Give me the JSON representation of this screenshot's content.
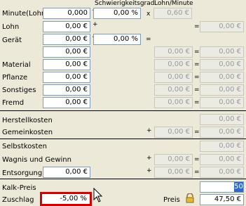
{
  "headers": {
    "difficulty": "Schwierigkeitsgrad",
    "wage_per_minute": "Lohn/Minute"
  },
  "operators": {
    "plus": "+",
    "times": "x",
    "equals": "="
  },
  "rows": {
    "minute_lohn": {
      "label": "Minute(Lohn)",
      "value": "0,000",
      "difficulty": "0,00 %",
      "wage": "0,60 €"
    },
    "lohn": {
      "label": "Lohn",
      "value": "0,00 €",
      "result": "0,00 €"
    },
    "geraet": {
      "label": "Gerät",
      "value": "0,00 €",
      "difficulty": "0,00 %"
    },
    "geraet2": {
      "value": "0,00 €",
      "result": "0,00 €"
    },
    "material": {
      "label": "Material",
      "value": "0,00 €",
      "result": "0,00 €"
    },
    "pflanze": {
      "label": "Pflanze",
      "value": "0,00 €",
      "result": "0,00 €"
    },
    "sonstiges": {
      "label": "Sonstiges",
      "value": "0,00 €",
      "result": "0,00 €"
    },
    "fremd": {
      "label": "Fremd",
      "value": "0,00 €",
      "result": "0,00 €"
    },
    "herstellkosten": {
      "label": "Herstellkosten",
      "result": "0,00 €"
    },
    "gemeinkosten": {
      "label": "Gemeinkosten",
      "value": "0,00 €",
      "result": "0,00 €"
    },
    "selbstkosten": {
      "label": "Selbstkosten",
      "result": "0,00 €"
    },
    "wagnis": {
      "label": "Wagnis und Gewinn",
      "value": "0,00 €",
      "result": "0,00 €"
    },
    "entsorgung": {
      "label": "Entsorgung",
      "value": "0,00 €",
      "extra": "0,00 €",
      "result": "0,00 €"
    },
    "kalk_preis": {
      "label": "Kalk-Preis",
      "selected": "50"
    },
    "zuschlag": {
      "label": "Zuschlag",
      "value": "-5,00 %"
    },
    "preis": {
      "label": "Preis",
      "value": "47,50 €"
    }
  }
}
